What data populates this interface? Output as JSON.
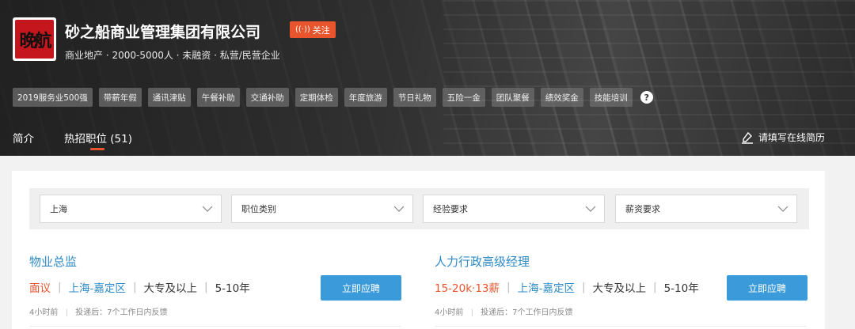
{
  "company": {
    "logo_text": "晚航",
    "name": "砂之船商业管理集团有限公司",
    "follow_label": "关注",
    "meta": "商业地产 · 2000-5000人 · 未融资 · 私营/民营企业"
  },
  "tags": [
    "2019服务业500强",
    "带薪年假",
    "通讯津贴",
    "午餐补助",
    "交通补助",
    "定期体检",
    "年度旅游",
    "节日礼物",
    "五险一金",
    "团队聚餐",
    "绩效奖金",
    "技能培训"
  ],
  "nav": {
    "intro": "简介",
    "jobs": "热招职位 (51)",
    "resume": "请填写在线简历"
  },
  "filters": {
    "city": "上海",
    "category": "职位类别",
    "experience": "经验要求",
    "salary": "薪资要求"
  },
  "jobs": [
    {
      "title": "物业总监",
      "salary": "面议",
      "location": "上海-嘉定区",
      "education": "大专及以上",
      "experience": "5-10年",
      "posted": "4小时前",
      "feedback": "投递后：7个工作日内反馈",
      "apply": "立即应聘"
    },
    {
      "title": "人力行政高级经理",
      "salary": "15-20k·13薪",
      "location": "上海-嘉定区",
      "education": "大专及以上",
      "experience": "5-10年",
      "posted": "4小时前",
      "feedback": "投递后：7个工作日内反馈",
      "apply": "立即应聘"
    }
  ],
  "colors": {
    "accent": "#e8552d",
    "link": "#2d8ac6",
    "button": "#3b9ad9"
  }
}
